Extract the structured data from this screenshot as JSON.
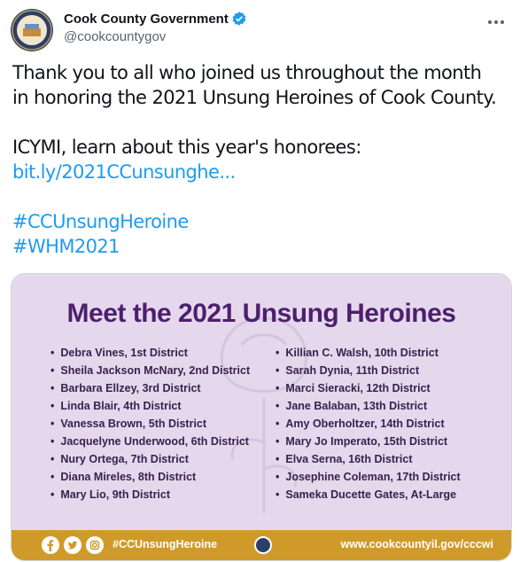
{
  "account": {
    "display_name": "Cook County Government",
    "handle": "@cookcountygov"
  },
  "tweet": {
    "line1": "Thank you to all who joined us throughout the month",
    "line2": "in honoring the 2021 Unsung Heroines of Cook County.",
    "line3": "ICYMI, learn about this year's honorees:",
    "link": "bit.ly/2021CCunsunghe...",
    "hashtag1": "#CCUnsungHeroine",
    "hashtag2": "#WHM2021"
  },
  "card": {
    "title": "Meet the 2021 Unsung Heroines",
    "left_list": [
      "Debra Vines, 1st District",
      "Sheila Jackson McNary, 2nd District",
      "Barbara Ellzey, 3rd District",
      "Linda Blair, 4th District",
      "Vanessa Brown, 5th District",
      "Jacquelyne Underwood, 6th District",
      "Nury Ortega, 7th District",
      "Diana Mireles, 8th District",
      "Mary Lio, 9th District"
    ],
    "right_list": [
      "Killian C. Walsh, 10th District",
      "Sarah Dynia, 11th District",
      "Marci Sieracki, 12th District",
      "Jane Balaban, 13th District",
      "Amy Oberholtzer, 14th District",
      "Mary Jo Imperato, 15th District",
      "Elva Serna, 16th District",
      "Josephine Coleman, 17th District",
      "Sameka Ducette Gates, At-Large"
    ],
    "footer_hashtag": "#CCUnsungHeroine",
    "footer_site": "www.cookcountyil.gov/cccwi"
  },
  "colors": {
    "link": "#1d9bf0",
    "card_bg": "#e5d8ec",
    "card_title": "#4d1f6e",
    "footer_bg": "#d09a2a"
  }
}
